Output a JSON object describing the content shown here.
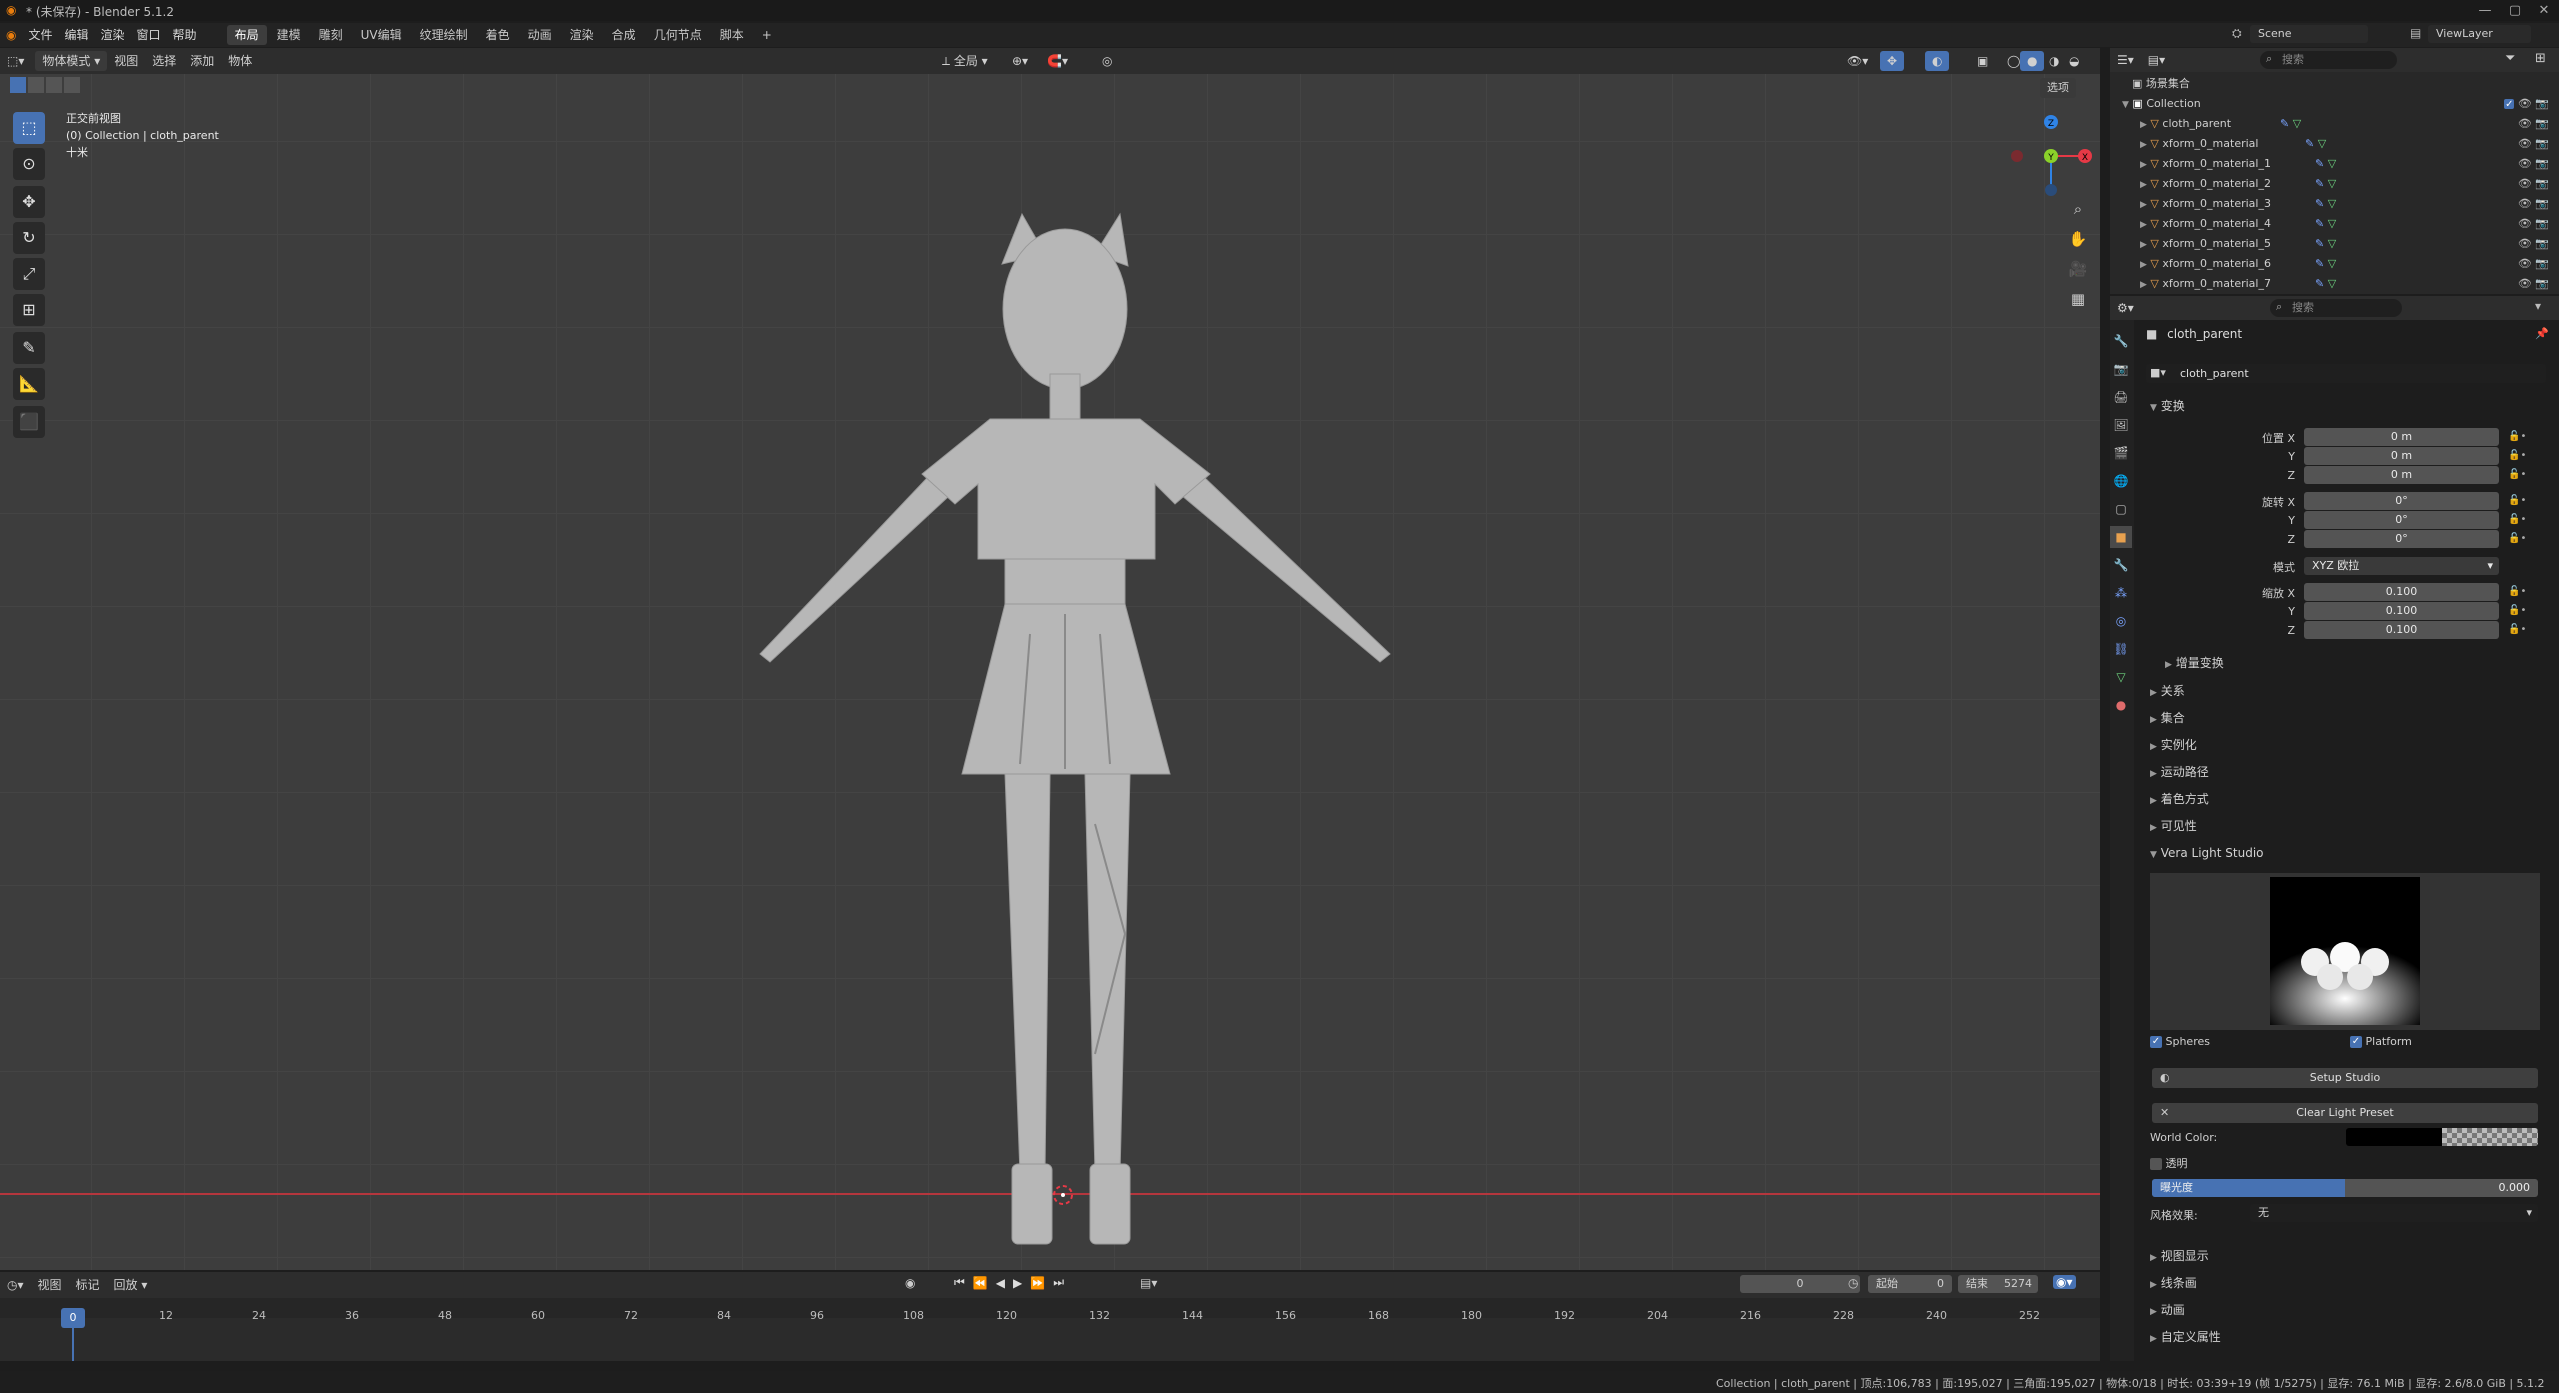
{
  "window": {
    "title": "* (未保存) - Blender 5.1.2"
  },
  "menubar": {
    "menus": [
      "文件",
      "编辑",
      "渲染",
      "窗口",
      "帮助"
    ],
    "workspaces": [
      "布局",
      "建模",
      "雕刻",
      "UV编辑",
      "纹理绘制",
      "着色",
      "动画",
      "渲染",
      "合成",
      "几何节点",
      "脚本"
    ],
    "active_workspace": "布局",
    "add_tab": "+",
    "scene": "Scene",
    "view_layer": "ViewLayer"
  },
  "viewport": {
    "mode": "物体模式",
    "menus": [
      "视图",
      "选择",
      "添加",
      "物体"
    ],
    "transform_orient": "全局",
    "options": "选项",
    "overlay_lines": [
      "正交前视图",
      "(0) Collection | cloth_parent",
      "十米"
    ],
    "gizmo": {
      "z": "Z",
      "y": "Y",
      "x": "X"
    }
  },
  "outliner": {
    "search_placeholder": "搜索",
    "root": "场景集合",
    "collection": "Collection",
    "items": [
      "cloth_parent",
      "xform_0_material",
      "xform_0_material_1",
      "xform_0_material_2",
      "xform_0_material_3",
      "xform_0_material_4",
      "xform_0_material_5",
      "xform_0_material_6",
      "xform_0_material_7"
    ]
  },
  "properties": {
    "search_placeholder": "搜索",
    "object_name": "cloth_parent",
    "datablock": "cloth_parent",
    "transform_title": "变换",
    "location_label": "位置 X",
    "location": [
      "0 m",
      "0 m",
      "0 m"
    ],
    "rotation_label": "旋转 X",
    "rotation": [
      "0°",
      "0°",
      "0°"
    ],
    "mode_label": "模式",
    "rotation_mode": "XYZ 欧拉",
    "scale_label": "缩放 X",
    "scale": [
      "0.100",
      "0.100",
      "0.100"
    ],
    "axis_y": "Y",
    "axis_z": "Z",
    "delta_transform": "增量变换",
    "sections_mid": [
      "关系",
      "集合",
      "实例化",
      "运动路径",
      "着色方式",
      "可见性"
    ],
    "vera_title": "Vera Light Studio",
    "spheres_label": "Spheres",
    "platform_label": "Platform",
    "setup_btn": "Setup Studio",
    "clear_btn": "Clear Light Preset",
    "world_color_label": "World Color:",
    "transparent_label": "透明",
    "exposure_label": "曝光度",
    "exposure_value": "0.000",
    "style_label": "风格效果:",
    "style_value": "无",
    "sections_bottom": [
      "视图显示",
      "线条画",
      "动画",
      "自定义属性"
    ]
  },
  "timeline": {
    "menus": [
      "视图",
      "标记",
      "回放"
    ],
    "current_frame": "0",
    "start_label": "起始",
    "start": "0",
    "end_label": "结束",
    "end": "5274",
    "frames": [
      "0",
      "12",
      "24",
      "36",
      "48",
      "60",
      "72",
      "84",
      "96",
      "108",
      "120",
      "132",
      "144",
      "156",
      "168",
      "180",
      "192",
      "204",
      "216",
      "228",
      "240",
      "252"
    ]
  },
  "status": {
    "text": "Collection | cloth_parent | 顶点:106,783 | 面:195,027 | 三角面:195,027 | 物体:0/18 | 时长: 03:39+19 (帧 1/5275) | 显存: 76.1 MiB | 显存: 2.6/8.0 GiB | 5.1.2"
  }
}
